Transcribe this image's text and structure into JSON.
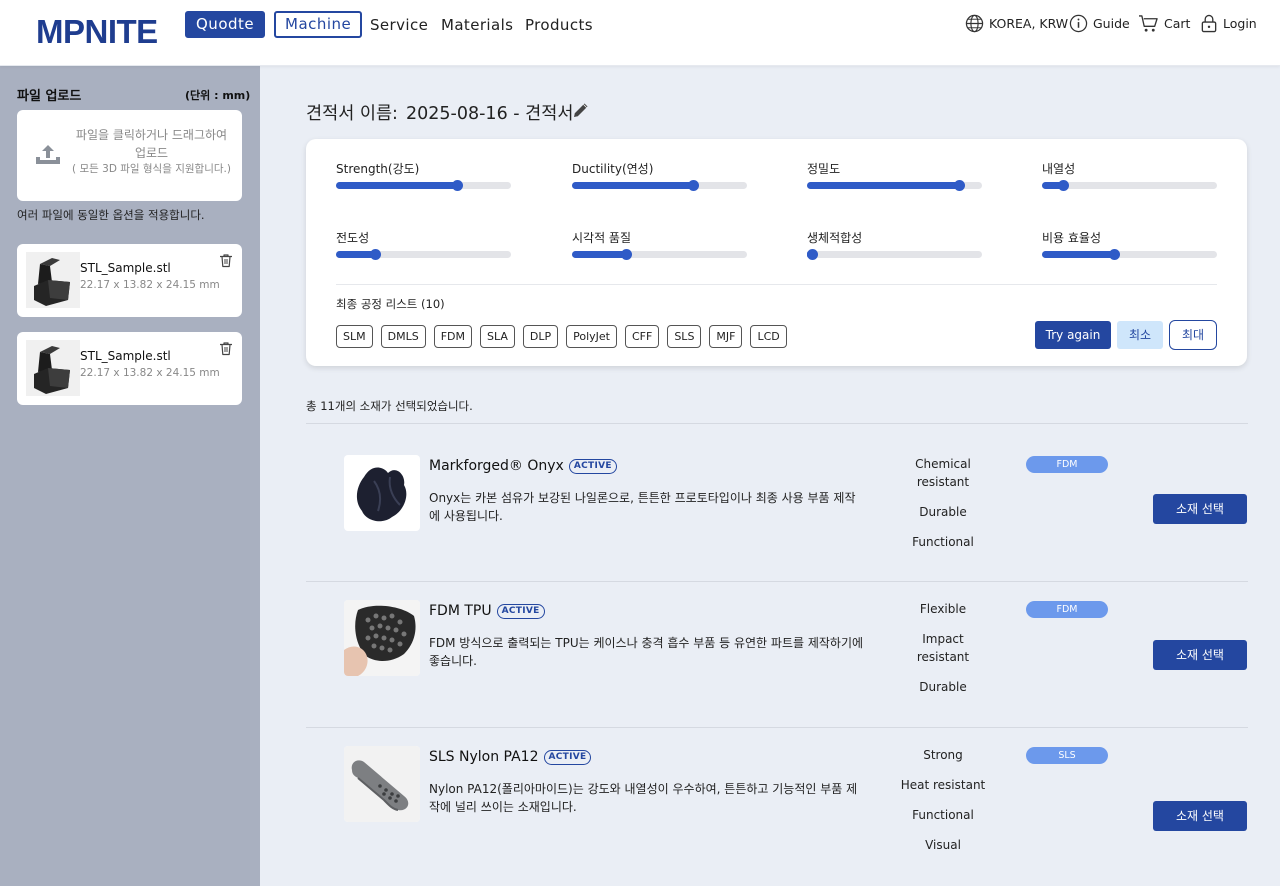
{
  "header": {
    "logo": "MPNITE",
    "quote_button": "Quodte",
    "machine_button": "Machine",
    "nav": [
      "Service",
      "Materials",
      "Products"
    ],
    "region": "KOREA, KRW",
    "guide": "Guide",
    "cart": "Cart",
    "login": "Login",
    "icons": [
      "globe-icon",
      "info-icon",
      "cart-icon",
      "lock-icon"
    ]
  },
  "sidebar": {
    "title": "파일 업로드",
    "unit": "(단위 : mm)",
    "upload_text": "파일을 클릭하거나 드래그하여 업로드",
    "upload_sub": "( 모든 3D 파일 형식을 지원합니다.)",
    "note": "여러 파일에 동일한 옵션을 적용합니다.",
    "files": [
      {
        "name": "STL_Sample.stl",
        "dims": "22.17 x 13.82 x 24.15 mm"
      },
      {
        "name": "STL_Sample.stl",
        "dims": "22.17 x 13.82 x 24.15 mm"
      }
    ]
  },
  "quote": {
    "label": "견적서 이름:",
    "name": "2025-08-16 - 견적서"
  },
  "sliders": [
    {
      "label": "Strength(강도)",
      "value": 0.69
    },
    {
      "label": "Ductility(연성)",
      "value": 0.69
    },
    {
      "label": "정밀도",
      "value": 0.87
    },
    {
      "label": "내열성",
      "value": 0.12
    },
    {
      "label": "전도성",
      "value": 0.22
    },
    {
      "label": "시각적 품질",
      "value": 0.31
    },
    {
      "label": "생체적합성",
      "value": 0.03
    },
    {
      "label": "비용 효율성",
      "value": 0.41
    }
  ],
  "process": {
    "label": "최종 공정 리스트 (10)",
    "chips": [
      "SLM",
      "DMLS",
      "FDM",
      "SLA",
      "DLP",
      "PolyJet",
      "CFF",
      "SLS",
      "MJF",
      "LCD"
    ],
    "try_again": "Try again",
    "min": "최소",
    "max": "최대"
  },
  "selected_count": "총 11개의 소재가 선택되었습니다.",
  "materials": [
    {
      "name": "Markforged® Onyx",
      "status": "ACTIVE",
      "desc": "Onyx는 카본 섬유가 보강된 나일론으로, 튼튼한 프로토타입이나 최종 사용 부품 제작에 사용됩니다.",
      "props": [
        "Chemical resistant",
        "Durable",
        "Functional"
      ],
      "process": "FDM",
      "select": "소재 선택"
    },
    {
      "name": "FDM TPU",
      "status": "ACTIVE",
      "desc": "FDM 방식으로 출력되는 TPU는 케이스나 충격 흡수 부품 등 유연한 파트를 제작하기에 좋습니다.",
      "props": [
        "Flexible",
        "Impact resistant",
        "Durable"
      ],
      "process": "FDM",
      "select": "소재 선택"
    },
    {
      "name": "SLS Nylon PA12",
      "status": "ACTIVE",
      "desc": "Nylon PA12(폴리아마이드)는 강도와 내열성이 우수하여, 튼튼하고 기능적인 부품 제작에 널리 쓰이는 소재입니다.",
      "props": [
        "Strong",
        "Heat resistant",
        "Functional",
        "Visual"
      ],
      "process": "SLS",
      "select": "소재 선택"
    }
  ],
  "colors": {
    "brand": "#2447a0",
    "sidebar": "#a9b0c0",
    "main_bg": "#eaeef5",
    "slider": "#2f5bc7",
    "tag": "#6c99ec"
  }
}
